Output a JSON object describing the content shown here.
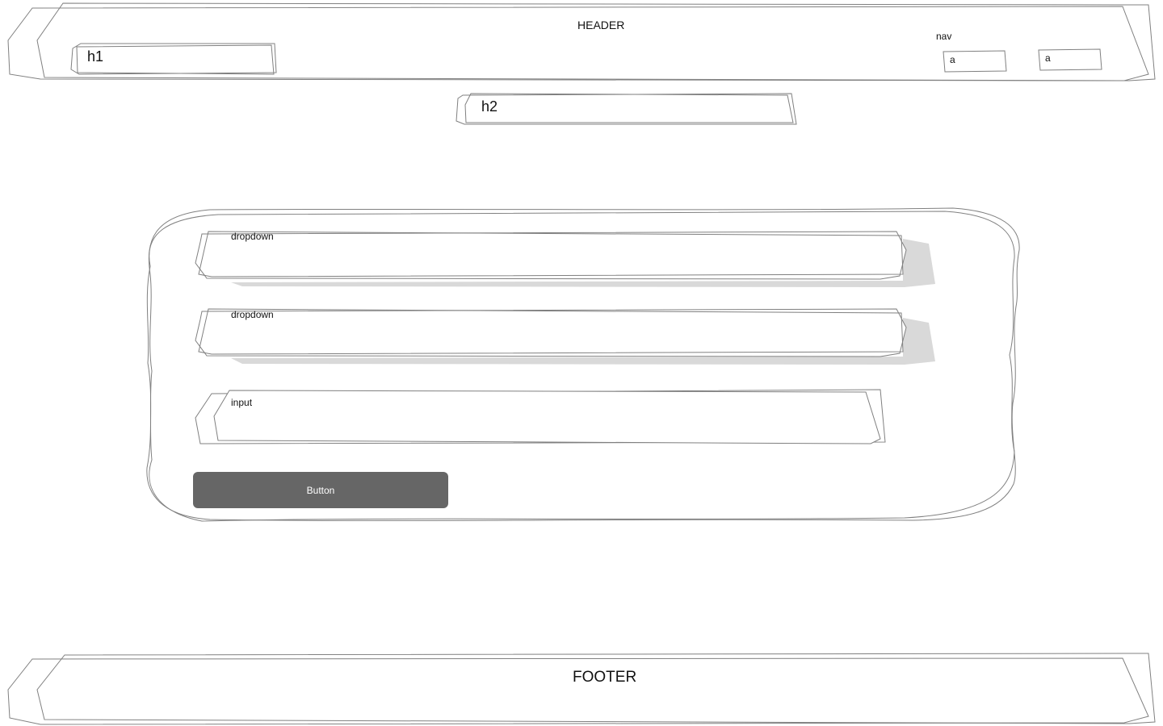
{
  "header": {
    "title": "HEADER",
    "h1": "h1"
  },
  "nav": {
    "title": "nav",
    "links": [
      {
        "label": "a"
      },
      {
        "label": "a"
      }
    ]
  },
  "subheading": {
    "h2": "h2"
  },
  "form": {
    "fields": [
      {
        "kind": "dropdown",
        "label": "dropdown"
      },
      {
        "kind": "dropdown",
        "label": "dropdown"
      },
      {
        "kind": "input",
        "label": "input"
      }
    ],
    "button_label": "Button"
  },
  "footer": {
    "title": "FOOTER"
  },
  "colors": {
    "stroke": "#808080",
    "shadow": "#d9d9d9",
    "button_fill": "#666666",
    "button_text": "#ffffff"
  }
}
